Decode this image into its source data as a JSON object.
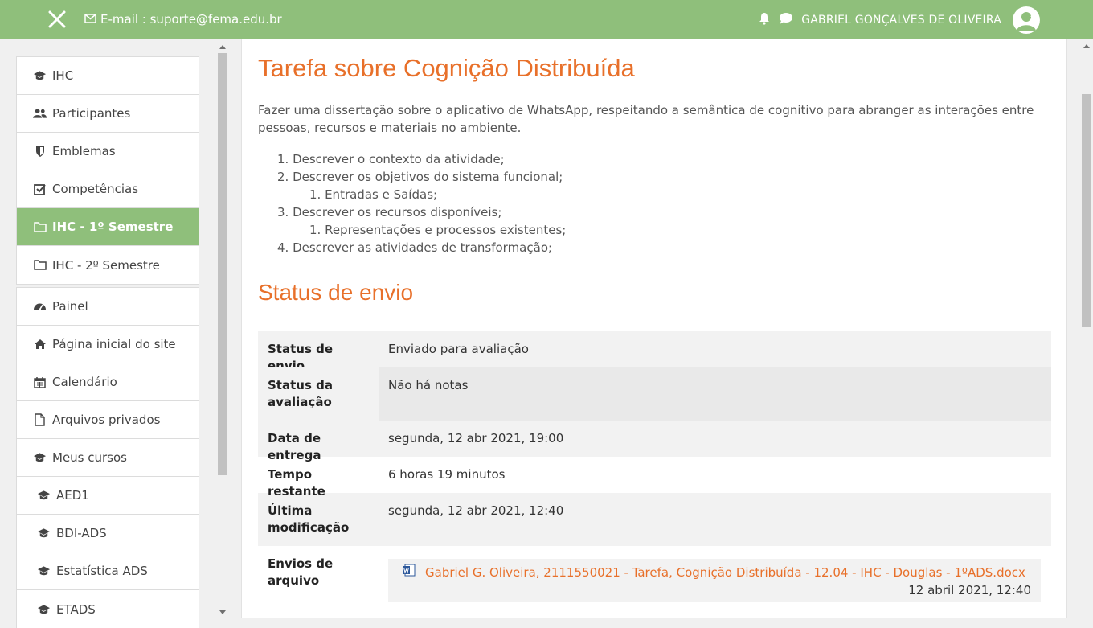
{
  "navbar": {
    "email_label": "E-mail : suporte@fema.edu.br",
    "user_name": "GABRIEL GONÇALVES DE OLIVEIRA",
    "accent_color": "#8fbf7b"
  },
  "sidebar": {
    "course_items": [
      {
        "label": "IHC",
        "icon": "graduation-cap-icon"
      },
      {
        "label": "Participantes",
        "icon": "users-icon"
      },
      {
        "label": "Emblemas",
        "icon": "shield-icon"
      },
      {
        "label": "Competências",
        "icon": "checkbox-icon"
      },
      {
        "label": "IHC - 1º Semestre",
        "icon": "folder-icon",
        "active": true
      },
      {
        "label": "IHC - 2º Semestre",
        "icon": "folder-icon"
      }
    ],
    "site_items": [
      {
        "label": "Painel",
        "icon": "dashboard-icon"
      },
      {
        "label": "Página inicial do site",
        "icon": "home-icon"
      },
      {
        "label": "Calendário",
        "icon": "calendar-icon"
      },
      {
        "label": "Arquivos privados",
        "icon": "file-icon"
      },
      {
        "label": "Meus cursos",
        "icon": "graduation-cap-icon"
      },
      {
        "label": "AED1",
        "icon": "graduation-cap-icon"
      },
      {
        "label": "BDI-ADS",
        "icon": "graduation-cap-icon"
      },
      {
        "label": "Estatística ADS",
        "icon": "graduation-cap-icon"
      },
      {
        "label": "ETADS",
        "icon": "graduation-cap-icon"
      }
    ]
  },
  "main": {
    "title": "Tarefa sobre Cognição Distribuída",
    "description": "Fazer uma dissertação sobre o aplicativo de WhatsApp, respeitando a semântica de cognitivo para abranger as interações entre pessoas, recursos e materiais no ambiente.",
    "list": [
      "1. Descrever o contexto da atividade;",
      "2. Descrever os objetivos do sistema funcional;",
      "1. Entradas e Saídas;",
      "3. Descrever os recursos disponíveis;",
      "1. Representações e processos existentes;",
      "4. Descrever as atividades de transformação;"
    ],
    "status_title": "Status de envio",
    "status": {
      "envio_label": "Status de envio",
      "envio_value": "Enviado para avaliação",
      "avaliacao_label_1": "Status da",
      "avaliacao_label_2": "avaliação",
      "avaliacao_value": "Não há notas",
      "entrega_label": "Data de entrega",
      "entrega_value": "segunda, 12 abr 2021, 19:00",
      "tempo_label": "Tempo restante",
      "tempo_value": "6 horas 19 minutos",
      "modificacao_label_1": "Última",
      "modificacao_label_2": "modificação",
      "modificacao_value": "segunda, 12 abr 2021, 12:40",
      "arquivo_label_1": "Envios de",
      "arquivo_label_2": "arquivo",
      "file_name": "Gabriel G. Oliveira, 2111550021 - Tarefa, Cognição Distribuída - 12.04 - IHC - Douglas - 1ºADS.docx",
      "file_date": "12 abril 2021, 12:40"
    }
  }
}
